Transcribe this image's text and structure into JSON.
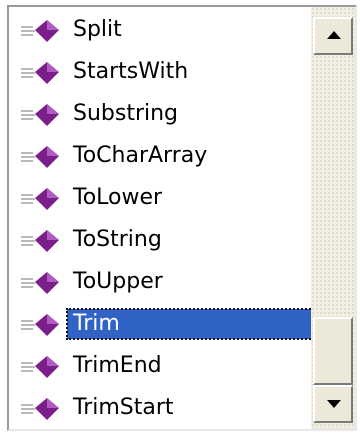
{
  "list": {
    "items": [
      {
        "label": "Split",
        "icon": "method-icon"
      },
      {
        "label": "StartsWith",
        "icon": "method-icon"
      },
      {
        "label": "Substring",
        "icon": "method-icon"
      },
      {
        "label": "ToCharArray",
        "icon": "method-icon"
      },
      {
        "label": "ToLower",
        "icon": "method-icon"
      },
      {
        "label": "ToString",
        "icon": "method-icon"
      },
      {
        "label": "ToUpper",
        "icon": "method-icon"
      },
      {
        "label": "Trim",
        "icon": "method-icon",
        "selected": true
      },
      {
        "label": "TrimEnd",
        "icon": "method-icon"
      },
      {
        "label": "TrimStart",
        "icon": "method-icon"
      }
    ],
    "selected_index": 7
  },
  "scrollbar": {
    "up_icon": "scroll-up-arrow-icon",
    "down_icon": "scroll-down-arrow-icon"
  },
  "colors": {
    "selection_bg": "#3163c6",
    "selection_text": "#ffffff",
    "method_icon": "#7a1f8a"
  }
}
